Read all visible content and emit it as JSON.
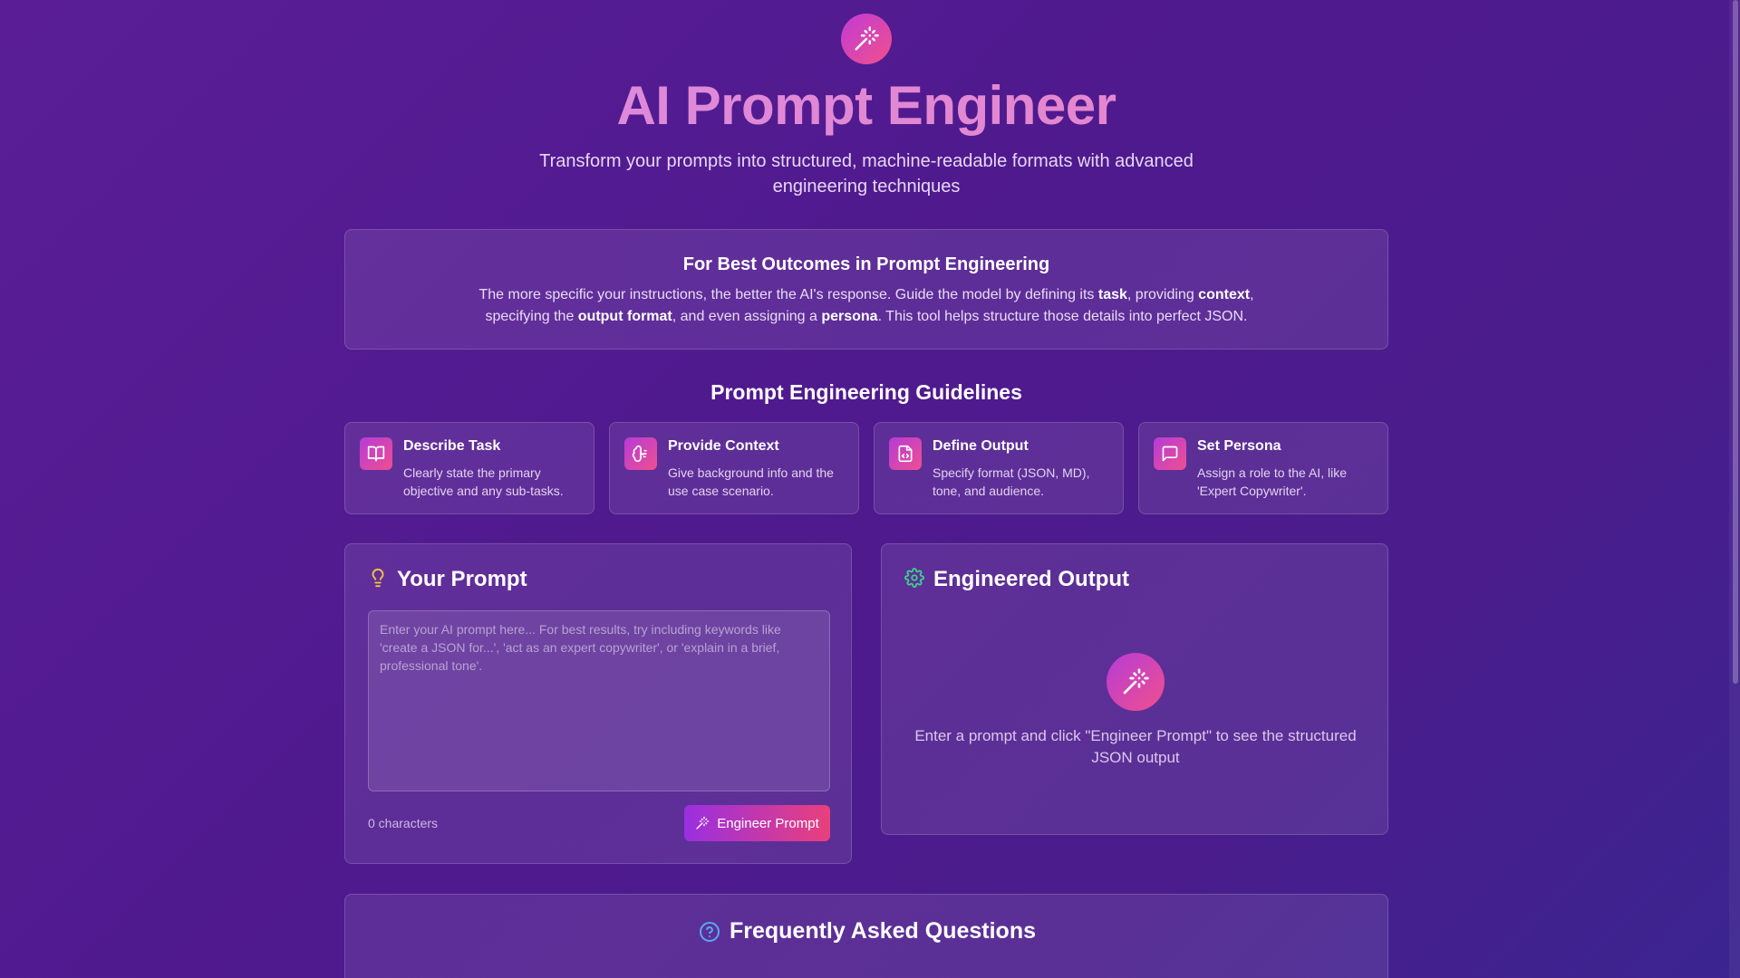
{
  "header": {
    "icon": "magic-wand-icon",
    "title": "AI Prompt Engineer",
    "subtitle": "Transform your prompts into structured, machine-readable formats with advanced engineering techniques"
  },
  "tips": {
    "heading": "For Best Outcomes in Prompt Engineering",
    "text_1": "The more specific your instructions, the better the AI's response. Guide the model by defining its ",
    "bold_task": "task",
    "text_2": ", providing ",
    "bold_context": "context",
    "text_3": ", specifying the ",
    "bold_output_format": "output format",
    "text_4": ", and even assigning a ",
    "bold_persona": "persona",
    "text_5": ". This tool helps structure those details into perfect JSON."
  },
  "guidelines": {
    "heading": "Prompt Engineering Guidelines",
    "items": [
      {
        "icon": "book-open-icon",
        "title": "Describe Task",
        "description": "Clearly state the primary objective and any sub-tasks."
      },
      {
        "icon": "brain-icon",
        "title": "Provide Context",
        "description": "Give background info and the use case scenario."
      },
      {
        "icon": "file-code-icon",
        "title": "Define Output",
        "description": "Specify format (JSON, MD), tone, and audience."
      },
      {
        "icon": "message-square-icon",
        "title": "Set Persona",
        "description": "Assign a role to the AI, like 'Expert Copywriter'."
      }
    ]
  },
  "prompt_panel": {
    "icon": "lightbulb-icon",
    "title": "Your Prompt",
    "placeholder": "Enter your AI prompt here... For best results, try including keywords like 'create a JSON for...', 'act as an expert copywriter', or 'explain in a brief, professional tone'.",
    "value": "",
    "char_count": "0 characters",
    "button_label": "Engineer Prompt"
  },
  "output_panel": {
    "icon": "gear-icon",
    "title": "Engineered Output",
    "empty_text": "Enter a prompt and click \"Engineer Prompt\" to see the structured JSON output"
  },
  "faq": {
    "icon": "help-circle-icon",
    "title": "Frequently Asked Questions"
  },
  "colors": {
    "background": "#521b92",
    "accent_gradient_start": "#b63bd8",
    "accent_gradient_end": "#f0508b",
    "title_pink": "#e58ad6",
    "lightbulb": "#f5c542",
    "gear_green": "#3ecf8e",
    "faq_blue": "#5aa8f0"
  }
}
